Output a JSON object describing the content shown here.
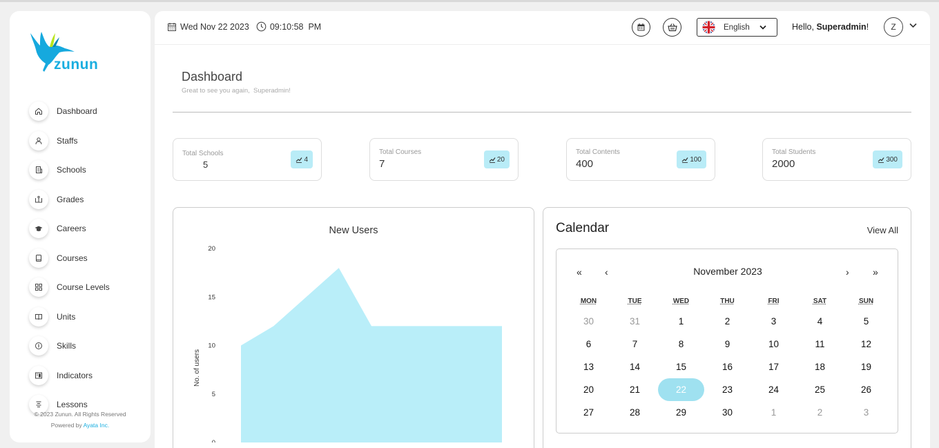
{
  "brand": {
    "name": "zunun",
    "color": "#19aee0"
  },
  "sidebar": {
    "items": [
      {
        "label": "Dashboard",
        "icon": "home-icon"
      },
      {
        "label": "Staffs",
        "icon": "user-icon"
      },
      {
        "label": "Schools",
        "icon": "building-icon"
      },
      {
        "label": "Grades",
        "icon": "book-open-icon"
      },
      {
        "label": "Careers",
        "icon": "graduation-cap-icon"
      },
      {
        "label": "Courses",
        "icon": "book-icon"
      },
      {
        "label": "Course Levels",
        "icon": "grid-icon"
      },
      {
        "label": "Units",
        "icon": "book-open-icon"
      },
      {
        "label": "Skills",
        "icon": "info-icon"
      },
      {
        "label": "Indicators",
        "icon": "panel-icon"
      },
      {
        "label": "Lessons",
        "icon": "list-icon"
      }
    ],
    "copyright": "© 2023 Zunun. All Rights Reserved",
    "powered_prefix": "Powered by",
    "powered_link": "Ayata Inc."
  },
  "header": {
    "date": "Wed Nov 22 2023",
    "time": "09:10:58  PM",
    "language": "English",
    "greeting": "Hello,",
    "username": "Superadmin",
    "greeting_suffix": "!",
    "avatar_initial": "Z"
  },
  "page": {
    "title": "Dashboard",
    "subtitle": "Great to see you again,  Superadmin!"
  },
  "stats": [
    {
      "label": "Total Schools",
      "value": "5",
      "badge": "4"
    },
    {
      "label": "Total Courses",
      "value": "7",
      "badge": "20"
    },
    {
      "label": "Total Contents",
      "value": "400",
      "badge": "100"
    },
    {
      "label": "Total Students",
      "value": "2000",
      "badge": "300"
    }
  ],
  "chart_data": {
    "type": "area",
    "title": "New Users",
    "xlabel": "",
    "ylabel": "No. of users",
    "ylim": [
      0,
      20
    ],
    "yticks": [
      "0",
      "5",
      "10",
      "15",
      "20"
    ],
    "series": [
      {
        "values": [
          10,
          12,
          15,
          18,
          12,
          12,
          12,
          12,
          12
        ]
      }
    ],
    "color": "#b9eef9",
    "grid": false
  },
  "calendar": {
    "title": "Calendar",
    "view_all": "View All",
    "month": "November 2023",
    "nav": {
      "prev_year": "«",
      "prev": "‹",
      "next": "›",
      "next_year": "»"
    },
    "weekdays": [
      "MON",
      "TUE",
      "WED",
      "THU",
      "FRI",
      "SAT",
      "SUN"
    ],
    "weeks": [
      [
        "30",
        "31",
        "1",
        "2",
        "3",
        "4",
        "5"
      ],
      [
        "6",
        "7",
        "8",
        "9",
        "10",
        "11",
        "12"
      ],
      [
        "13",
        "14",
        "15",
        "16",
        "17",
        "18",
        "19"
      ],
      [
        "20",
        "21",
        "22",
        "23",
        "24",
        "25",
        "26"
      ],
      [
        "27",
        "28",
        "29",
        "30",
        "1",
        "2",
        "3"
      ]
    ],
    "selected": "22",
    "selected_color": "#9fe1f0"
  }
}
